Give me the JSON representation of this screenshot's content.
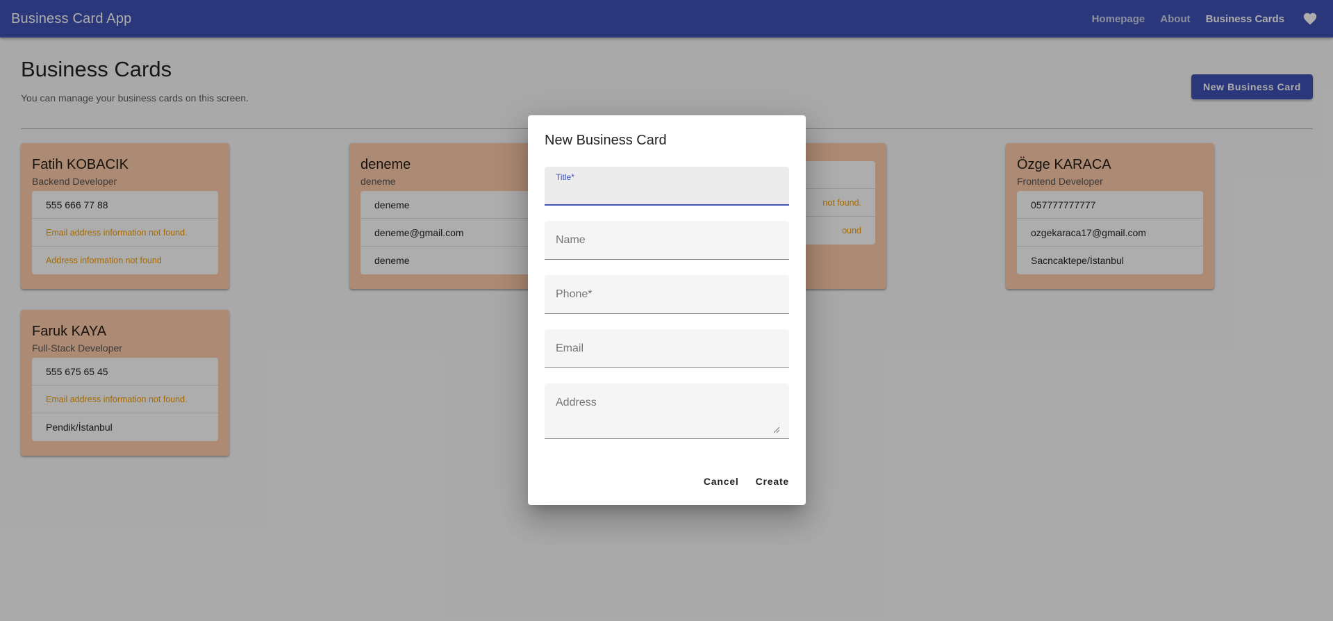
{
  "app": {
    "title": "Business Card App",
    "nav": [
      {
        "label": "Homepage"
      },
      {
        "label": "About"
      },
      {
        "label": "Business Cards",
        "active": true
      }
    ],
    "favorite_icon": "heart-icon"
  },
  "page": {
    "title": "Business Cards",
    "subtitle": "You can manage your business cards on this screen.",
    "new_button": "New Business Card"
  },
  "cards": [
    {
      "name": "Fatih KOBACIK",
      "title": "Backend Developer",
      "phone": "555 666 77 88",
      "email": "Email address information not found.",
      "address": "Address information not found"
    },
    {
      "name": "deneme",
      "title": "deneme",
      "phone": "deneme",
      "email": "deneme@gmail.com",
      "address": "deneme"
    },
    {
      "name": "",
      "title": "",
      "phone": "",
      "email": "not found.",
      "address": "ound"
    },
    {
      "name": "Özge KARACA",
      "title": "Frontend Developer",
      "phone": "057777777777",
      "email": "ozgekaraca17@gmail.com",
      "address": "Sacncaktepe/İstanbul"
    },
    {
      "name": "Faruk KAYA",
      "title": "Full-Stack Developer",
      "phone": "555 675 65 45",
      "email": "Email address information not found.",
      "address": "Pendik/İstanbul"
    }
  ],
  "dialog": {
    "title": "New Business Card",
    "fields": [
      {
        "label": "Title*",
        "value": ""
      },
      {
        "label": "Name",
        "value": ""
      },
      {
        "label": "Phone*",
        "value": ""
      },
      {
        "label": "Email",
        "value": ""
      },
      {
        "label": "Address",
        "value": ""
      }
    ],
    "cancel": "Cancel",
    "create": "Create"
  },
  "colors": {
    "primary": "#3f51b5",
    "card_background": "#ffccaa",
    "warning_text": "#f59c00"
  }
}
